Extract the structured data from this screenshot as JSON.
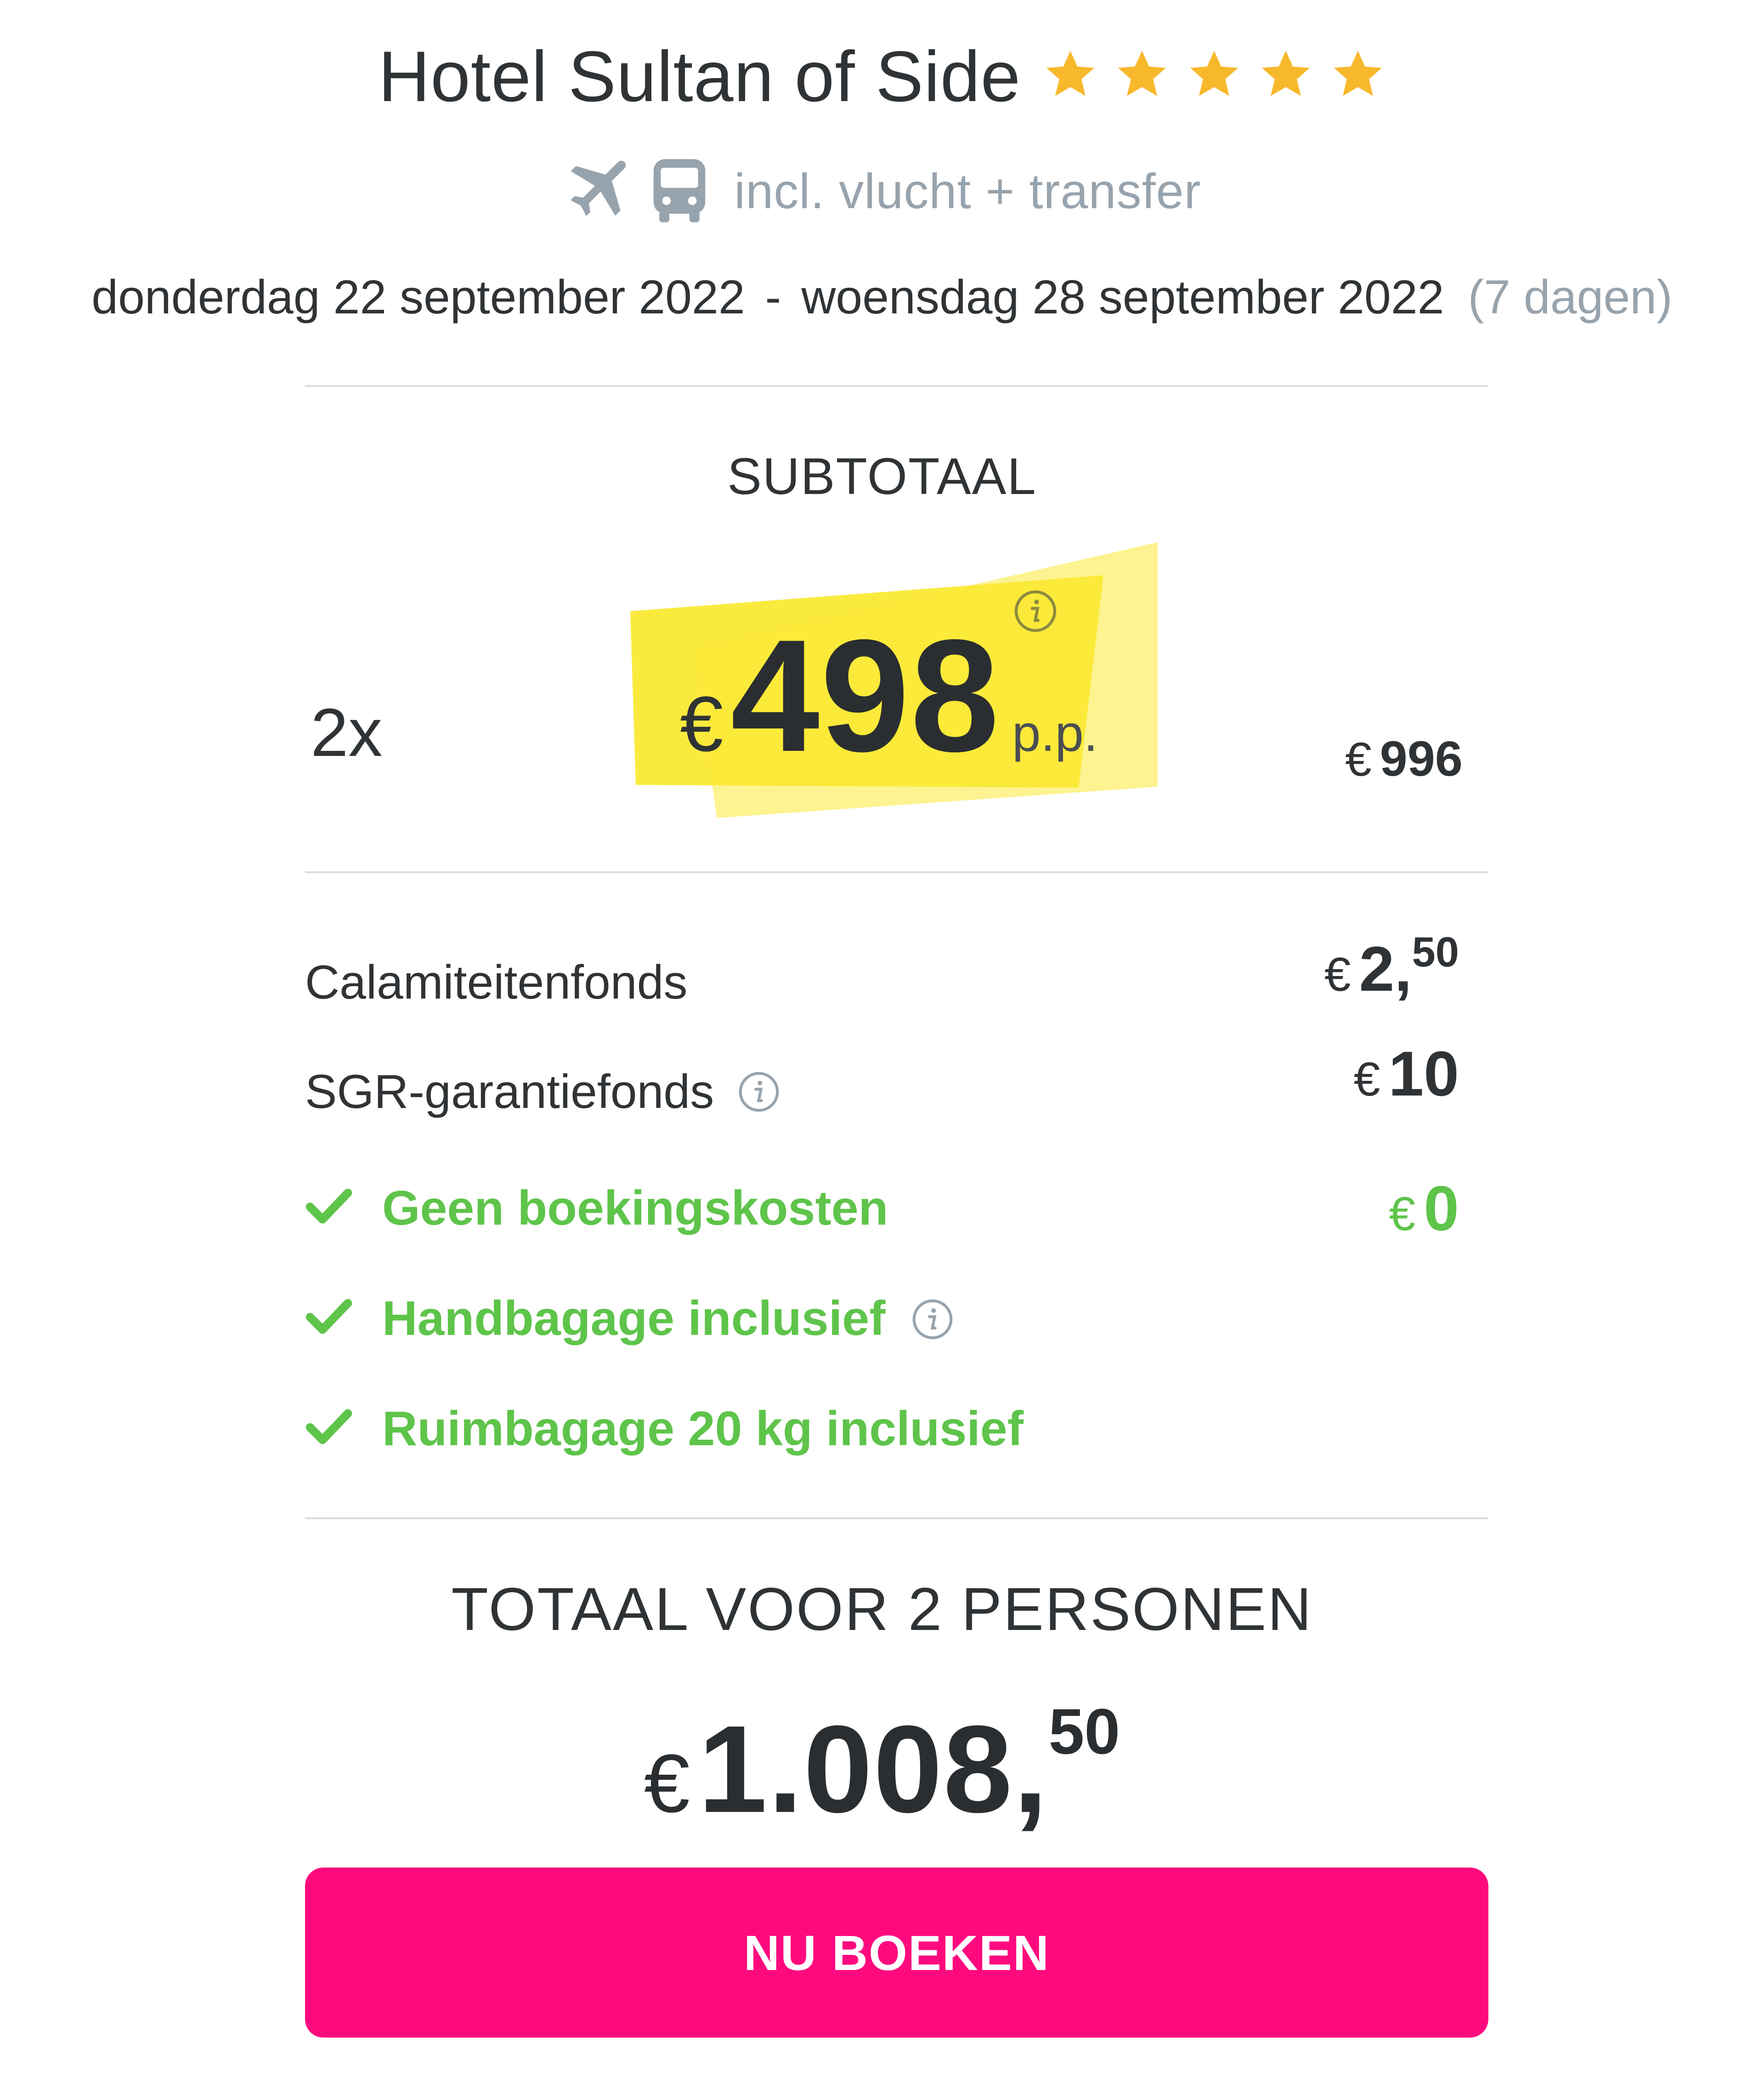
{
  "header": {
    "hotel_name": "Hotel Sultan of Side",
    "star_rating": 5,
    "star_color": "#f7b82b",
    "transport": {
      "icons": [
        "plane-icon",
        "bus-icon"
      ],
      "text": "incl. vlucht + transfer"
    },
    "dates": {
      "start": "donderdag 22 september 2022",
      "separator": "-",
      "end": "woensdag 28 september 2022",
      "duration": "(7 dagen)"
    }
  },
  "subtotal": {
    "label": "SUBTOTAAL",
    "persons": "2x",
    "currency": "€",
    "price_per_person": "498",
    "per_person_suffix": "p.p.",
    "total_currency": "€",
    "total": "996",
    "highlight_color": "#fbe934"
  },
  "fees": [
    {
      "label": "Calamiteitenfonds",
      "currency": "€",
      "value": "2,",
      "cents": "50"
    },
    {
      "label": "SGR-garantiefonds",
      "currency": "€",
      "value": "10",
      "cents": ""
    }
  ],
  "included": [
    {
      "label": "Geen boekingskosten",
      "currency": "€",
      "value": "0"
    },
    {
      "label": "Handbagage inclusief"
    },
    {
      "label": "Ruimbagage 20 kg inclusief"
    }
  ],
  "total": {
    "label": "TOTAAL VOOR 2 PERSONEN",
    "currency": "€",
    "value": "1.008,",
    "cents": "50"
  },
  "cta": {
    "label": "NU BOEKEN",
    "color": "#fe0a7e"
  },
  "colors": {
    "text": "#2f3336",
    "muted": "#97a3ad",
    "success": "#5ec44a",
    "divider": "#d5dde4"
  }
}
